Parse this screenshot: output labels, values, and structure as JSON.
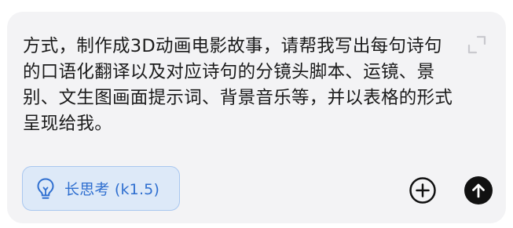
{
  "composer": {
    "prompt_text": "方式，制作成3D动画电影故事，请帮我写出每句诗句的口语化翻译以及对应诗句的分镜头脚本、运镜、景别、文生图画面提示词、背景音乐等，并以表格的形式呈现给我。",
    "expand_icon": "expand-icon",
    "mode_chip": {
      "icon": "lightbulb-icon",
      "label": "长思考 (k1.5)",
      "active": true
    },
    "add_icon": "plus-circle-icon",
    "send_icon": "arrow-up-icon"
  },
  "colors": {
    "composer_background": "#f3f3f5",
    "text": "#1a1a1a",
    "chip_background": "#dde9f8",
    "chip_border": "#a9c7ef",
    "chip_accent": "#2f6fd0",
    "send_button": "#111111"
  }
}
